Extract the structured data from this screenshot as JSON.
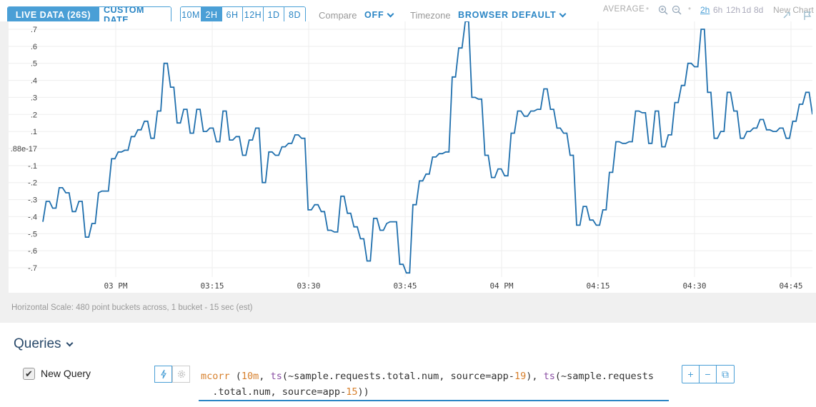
{
  "toolbar": {
    "live_data": "LIVE DATA (26S)",
    "custom_date": "CUSTOM DATE",
    "ranges": [
      "10M",
      "2H",
      "6H",
      "12H",
      "1D",
      "8D"
    ],
    "active_range": "2H",
    "compare_label": "Compare",
    "compare_value": "OFF",
    "timezone_label": "Timezone",
    "timezone_value": "BROWSER DEFAULT",
    "aggregation": "AVERAGE",
    "mini_ranges": [
      "2h",
      "6h",
      "12h",
      "1d",
      "8d"
    ],
    "new_chart": "New Chart"
  },
  "chart_data": {
    "type": "line",
    "title": "",
    "xlabel": "",
    "ylabel": "",
    "x_ticks": [
      "03 PM",
      "03:15",
      "03:30",
      "03:45",
      "04 PM",
      "04:15",
      "04:30",
      "04:45"
    ],
    "y_ticks": [
      ".7",
      ".6",
      ".5",
      ".4",
      ".3",
      ".2",
      ".1",
      ".88e-17",
      "-.1",
      "-.2",
      "-.3",
      "-.4",
      "-.5",
      "-.6",
      "-.7"
    ],
    "ylim": [
      -0.75,
      0.75
    ],
    "grid": true,
    "series": [
      {
        "color": "#1f6fad",
        "points": [
          [
            0,
            -0.43
          ],
          [
            0.5,
            -0.31
          ],
          [
            1,
            -0.31
          ],
          [
            1.5,
            -0.35
          ],
          [
            2,
            -0.35
          ],
          [
            2.5,
            -0.23
          ],
          [
            3,
            -0.23
          ],
          [
            3.5,
            -0.26
          ],
          [
            4,
            -0.26
          ],
          [
            4.5,
            -0.37
          ],
          [
            5,
            -0.37
          ],
          [
            5.5,
            -0.31
          ],
          [
            6,
            -0.31
          ],
          [
            6.5,
            -0.52
          ],
          [
            7,
            -0.52
          ],
          [
            7.5,
            -0.44
          ],
          [
            8,
            -0.44
          ],
          [
            8.5,
            -0.26
          ],
          [
            9,
            -0.25
          ],
          [
            9.5,
            -0.25
          ],
          [
            10,
            -0.25
          ],
          [
            10.5,
            -0.06
          ],
          [
            11,
            -0.06
          ],
          [
            11.5,
            -0.02
          ],
          [
            12,
            -0.02
          ],
          [
            12.5,
            -0.01
          ],
          [
            13,
            -0.01
          ],
          [
            13.5,
            0.07
          ],
          [
            14,
            0.07
          ],
          [
            14.5,
            0.11
          ],
          [
            15,
            0.11
          ],
          [
            15.5,
            0.16
          ],
          [
            16,
            0.16
          ],
          [
            16.5,
            0.06
          ],
          [
            17,
            0.06
          ],
          [
            17.5,
            0.22
          ],
          [
            18,
            0.22
          ],
          [
            18.5,
            0.5
          ],
          [
            19,
            0.5
          ],
          [
            19.5,
            0.36
          ],
          [
            20,
            0.36
          ],
          [
            20.5,
            0.15
          ],
          [
            21,
            0.15
          ],
          [
            21.5,
            0.23
          ],
          [
            22,
            0.23
          ],
          [
            22.5,
            0.09
          ],
          [
            23,
            0.09
          ],
          [
            23.5,
            0.23
          ],
          [
            24,
            0.23
          ],
          [
            24.5,
            0.1
          ],
          [
            25,
            0.1
          ],
          [
            25.5,
            0.12
          ],
          [
            26,
            0.12
          ],
          [
            26.5,
            0.04
          ],
          [
            27,
            0.04
          ],
          [
            27.5,
            0.22
          ],
          [
            28,
            0.22
          ],
          [
            28.5,
            0.05
          ],
          [
            29,
            0.05
          ],
          [
            29.5,
            0.07
          ],
          [
            30,
            0.07
          ],
          [
            30.5,
            -0.04
          ],
          [
            31,
            -0.04
          ],
          [
            31.5,
            0.05
          ],
          [
            32,
            0.05
          ],
          [
            32.5,
            0.12
          ],
          [
            33,
            0.12
          ],
          [
            33.5,
            -0.2
          ],
          [
            34,
            -0.2
          ],
          [
            34.5,
            -0.02
          ],
          [
            35,
            -0.02
          ],
          [
            35.5,
            -0.04
          ],
          [
            36,
            -0.04
          ],
          [
            36.5,
            0.01
          ],
          [
            37,
            0.01
          ],
          [
            37.5,
            0.03
          ],
          [
            38,
            0.03
          ],
          [
            38.5,
            0.08
          ],
          [
            39,
            0.08
          ],
          [
            39.5,
            0.06
          ],
          [
            40,
            0.06
          ],
          [
            40.5,
            -0.36
          ],
          [
            41,
            -0.36
          ],
          [
            41.5,
            -0.33
          ],
          [
            42,
            -0.33
          ],
          [
            42.5,
            -0.37
          ],
          [
            43,
            -0.37
          ],
          [
            43.5,
            -0.48
          ],
          [
            44,
            -0.48
          ],
          [
            44.5,
            -0.49
          ],
          [
            45,
            -0.49
          ],
          [
            45.5,
            -0.28
          ],
          [
            46,
            -0.28
          ],
          [
            46.5,
            -0.38
          ],
          [
            47,
            -0.38
          ],
          [
            47.5,
            -0.46
          ],
          [
            48,
            -0.46
          ],
          [
            48.5,
            -0.53
          ],
          [
            49,
            -0.53
          ],
          [
            49.5,
            -0.66
          ],
          [
            50,
            -0.66
          ],
          [
            50.5,
            -0.41
          ],
          [
            51,
            -0.41
          ],
          [
            51.5,
            -0.48
          ],
          [
            52,
            -0.48
          ],
          [
            52.5,
            -0.44
          ],
          [
            53,
            -0.43
          ],
          [
            53.5,
            -0.43
          ],
          [
            54,
            -0.43
          ],
          [
            54.5,
            -0.68
          ],
          [
            55,
            -0.68
          ],
          [
            55.5,
            -0.73
          ],
          [
            56,
            -0.73
          ],
          [
            56.5,
            -0.33
          ],
          [
            57,
            -0.33
          ],
          [
            57.5,
            -0.19
          ],
          [
            58,
            -0.19
          ],
          [
            58.5,
            -0.15
          ],
          [
            59,
            -0.15
          ],
          [
            59.5,
            -0.05
          ],
          [
            60,
            -0.05
          ],
          [
            60.5,
            -0.03
          ],
          [
            61,
            -0.03
          ],
          [
            61.5,
            -0.02
          ],
          [
            62,
            -0.02
          ],
          [
            62.5,
            0.42
          ],
          [
            63,
            0.42
          ],
          [
            63.5,
            0.59
          ],
          [
            64,
            0.59
          ],
          [
            64.5,
            0.75
          ],
          [
            65,
            0.75
          ],
          [
            65.5,
            0.3
          ],
          [
            66,
            0.3
          ],
          [
            66.5,
            0.29
          ],
          [
            67,
            0.29
          ],
          [
            67.5,
            -0.04
          ],
          [
            68,
            -0.04
          ],
          [
            68.5,
            -0.17
          ],
          [
            69,
            -0.17
          ],
          [
            69.5,
            -0.12
          ],
          [
            70,
            -0.12
          ],
          [
            70.5,
            -0.16
          ],
          [
            71,
            -0.16
          ],
          [
            71.5,
            0.09
          ],
          [
            72,
            0.09
          ],
          [
            72.5,
            0.22
          ],
          [
            73,
            0.22
          ],
          [
            73.5,
            0.19
          ],
          [
            74,
            0.19
          ],
          [
            74.5,
            0.22
          ],
          [
            75,
            0.22
          ],
          [
            75.5,
            0.23
          ],
          [
            76,
            0.23
          ],
          [
            76.5,
            0.35
          ],
          [
            77,
            0.35
          ],
          [
            77.5,
            0.23
          ],
          [
            78,
            0.23
          ],
          [
            78.5,
            0.12
          ],
          [
            79,
            0.12
          ],
          [
            79.5,
            0.09
          ],
          [
            80,
            0.09
          ],
          [
            80.5,
            -0.04
          ],
          [
            81,
            -0.04
          ],
          [
            81.5,
            -0.45
          ],
          [
            82,
            -0.45
          ],
          [
            82.5,
            -0.34
          ],
          [
            83,
            -0.34
          ],
          [
            83.5,
            -0.42
          ],
          [
            84,
            -0.42
          ],
          [
            84.5,
            -0.45
          ],
          [
            85,
            -0.45
          ],
          [
            85.5,
            -0.36
          ],
          [
            86,
            -0.36
          ],
          [
            86.5,
            -0.14
          ],
          [
            87,
            -0.14
          ],
          [
            87.5,
            0.04
          ],
          [
            88,
            0.04
          ],
          [
            88.5,
            0.03
          ],
          [
            89,
            0.03
          ],
          [
            89.5,
            0.04
          ],
          [
            90,
            0.04
          ],
          [
            90.5,
            0.22
          ],
          [
            91,
            0.22
          ],
          [
            91.5,
            0.21
          ],
          [
            92,
            0.21
          ],
          [
            92.5,
            0.03
          ],
          [
            93,
            0.03
          ],
          [
            93.5,
            0.22
          ],
          [
            94,
            0.22
          ],
          [
            94.5,
            0.01
          ],
          [
            95,
            0.01
          ],
          [
            95.5,
            0.08
          ],
          [
            96,
            0.08
          ],
          [
            96.5,
            0.27
          ],
          [
            97,
            0.27
          ],
          [
            97.5,
            0.37
          ],
          [
            98,
            0.37
          ],
          [
            98.5,
            0.5
          ],
          [
            99,
            0.5
          ],
          [
            99.5,
            0.48
          ],
          [
            100,
            0.48
          ],
          [
            100.5,
            0.7
          ],
          [
            101,
            0.7
          ],
          [
            101.5,
            0.33
          ],
          [
            102,
            0.33
          ],
          [
            102.5,
            0.06
          ],
          [
            103,
            0.06
          ],
          [
            103.5,
            0.1
          ],
          [
            104,
            0.1
          ],
          [
            104.5,
            0.33
          ],
          [
            105,
            0.33
          ],
          [
            105.5,
            0.22
          ],
          [
            106,
            0.22
          ],
          [
            106.5,
            0.06
          ],
          [
            107,
            0.06
          ],
          [
            107.5,
            0.1
          ],
          [
            108,
            0.1
          ],
          [
            108.5,
            0.12
          ],
          [
            109,
            0.12
          ],
          [
            109.5,
            0.17
          ],
          [
            110,
            0.17
          ],
          [
            110.5,
            0.11
          ],
          [
            111,
            0.11
          ],
          [
            111.5,
            0.1
          ],
          [
            112,
            0.1
          ],
          [
            112.5,
            0.12
          ],
          [
            113,
            0.12
          ],
          [
            113.5,
            0.06
          ],
          [
            114,
            0.06
          ],
          [
            114.5,
            0.16
          ],
          [
            115,
            0.16
          ],
          [
            115.5,
            0.26
          ],
          [
            116,
            0.26
          ],
          [
            116.5,
            0.33
          ],
          [
            117,
            0.33
          ],
          [
            117.5,
            0.2
          ]
        ]
      }
    ]
  },
  "hscale_text": "Horizontal Scale: 480 point buckets across, 1 bucket - 15 sec (est)",
  "queries": {
    "title": "Queries",
    "query_name": "New Query",
    "checked": true,
    "expression_line1": [
      {
        "t": "mcorr",
        "c": "fn"
      },
      {
        "t": " (",
        "c": ""
      },
      {
        "t": "10m",
        "c": "num"
      },
      {
        "t": ", ",
        "c": ""
      },
      {
        "t": "ts",
        "c": "ts"
      },
      {
        "t": "(~sample.requests.total.num, source=app-",
        "c": ""
      },
      {
        "t": "19",
        "c": "num"
      },
      {
        "t": "), ",
        "c": ""
      },
      {
        "t": "ts",
        "c": "ts"
      },
      {
        "t": "(~sample.requests",
        "c": ""
      }
    ],
    "expression_line2": [
      {
        "t": "  .total.num, source=app-",
        "c": ""
      },
      {
        "t": "15",
        "c": "num"
      },
      {
        "t": "))",
        "c": ""
      }
    ],
    "controls": [
      "+",
      "−",
      "⧉"
    ]
  }
}
